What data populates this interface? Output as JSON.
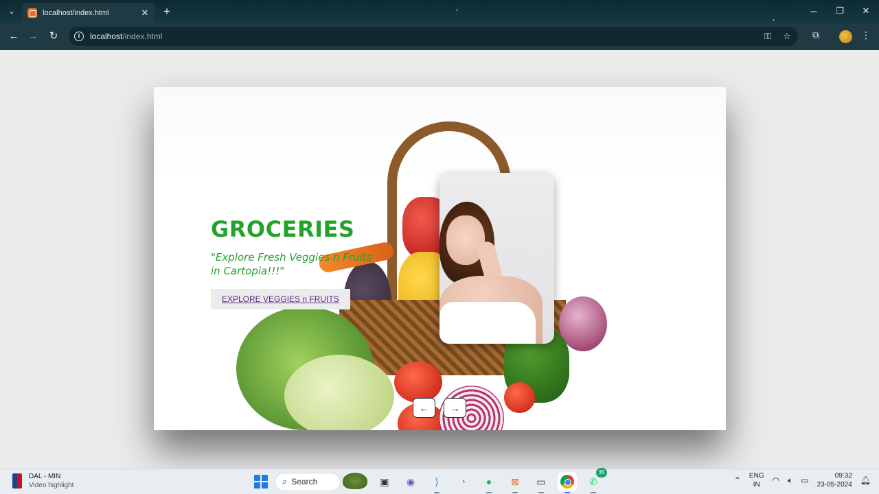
{
  "browser": {
    "tab_title": "localhost/index.html",
    "tab_close": "✕",
    "new_tab": "+",
    "url_host": "localhost",
    "url_path": "/index.html",
    "win_minimize": "─",
    "win_restore": "❐",
    "win_close": "✕"
  },
  "page": {
    "hero_title": "GROCERIES",
    "hero_subtitle": "\"Explore Fresh Veggies n Fruits in Cartopia!!!\"",
    "hero_button": "EXPLORE VEGGIES n FRUITS",
    "prev_arrow": "←",
    "next_arrow": "→",
    "colors": {
      "accent_green": "#23a32a",
      "button_link": "#5b2a8a"
    }
  },
  "taskbar": {
    "widget_title": "DAL - MIN",
    "widget_subtitle": "Video highlight",
    "search_placeholder": "Search",
    "whatsapp_badge": "35",
    "lang_primary": "ENG",
    "lang_secondary": "IN",
    "time": "09:32",
    "date": "23-05-2024"
  }
}
